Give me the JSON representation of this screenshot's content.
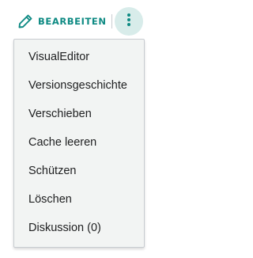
{
  "toolbar": {
    "edit_icon": "pencil-icon",
    "edit_label": "BEARBEITEN",
    "more_icon": "vertical-ellipsis-icon",
    "accent_color": "#0e8a83",
    "more_button_bg": "#d8ecea"
  },
  "menu": {
    "items": [
      {
        "label": "VisualEditor"
      },
      {
        "label": "Versionsgeschichte"
      },
      {
        "label": "Verschieben"
      },
      {
        "label": "Cache leeren"
      },
      {
        "label": "Schützen"
      },
      {
        "label": "Löschen"
      },
      {
        "label": "Diskussion (0)"
      }
    ]
  }
}
